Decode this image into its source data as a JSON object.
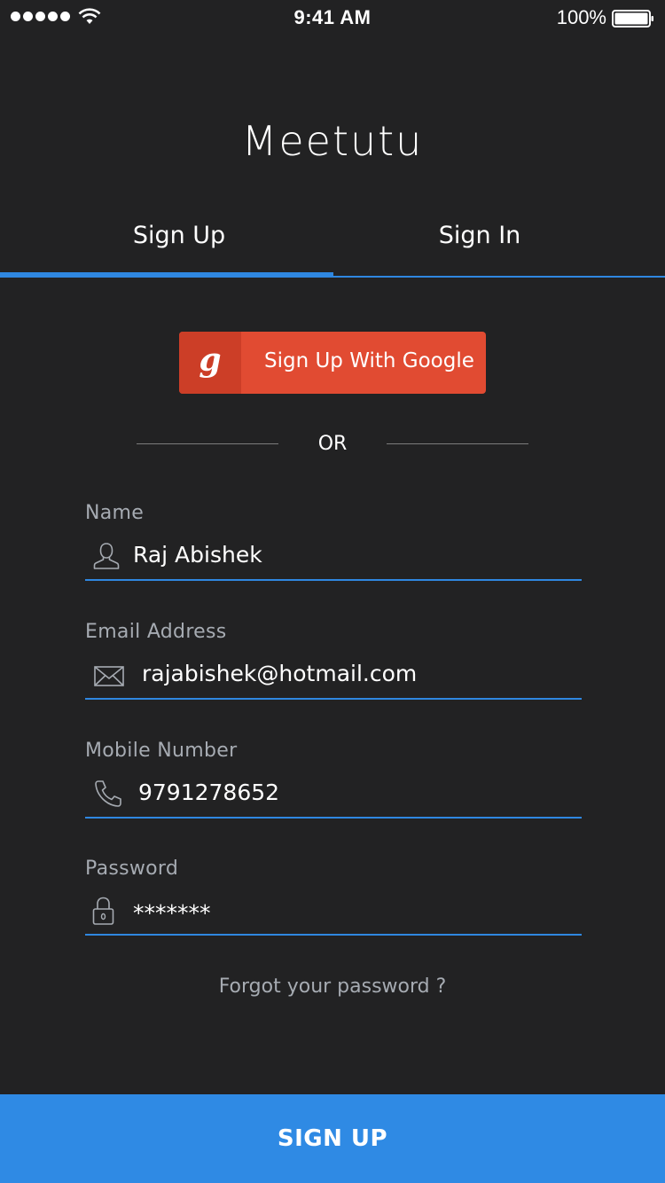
{
  "status_bar": {
    "time": "9:41 AM",
    "battery": "100%",
    "signal_icon": "signal-dots-icon",
    "wifi_icon": "wifi-icon",
    "battery_icon": "battery-icon"
  },
  "app": {
    "title": "Meetutu"
  },
  "tabs": [
    {
      "label": "Sign Up",
      "active": true
    },
    {
      "label": "Sign In",
      "active": false
    }
  ],
  "google_button": {
    "icon_glyph": "g",
    "label": "Sign Up With Google",
    "color": "#e14b32"
  },
  "divider": {
    "label": "OR"
  },
  "fields": {
    "name": {
      "label": "Name",
      "value": "Raj Abishek",
      "icon": "user-icon"
    },
    "email": {
      "label": "Email Address",
      "value": "rajabishek@hotmail.com",
      "icon": "envelope-icon"
    },
    "mobile": {
      "label": "Mobile Number",
      "value": "9791278652",
      "icon": "phone-icon"
    },
    "password": {
      "label": "Password",
      "value": "*******",
      "icon": "lock-icon"
    }
  },
  "forgot_password": "Forgot your password ?",
  "submit_button": "SIGN UP",
  "colors": {
    "accent": "#2f87e0",
    "background": "#222223",
    "google_red": "#e14b32",
    "label_gray": "#a6abb2"
  }
}
